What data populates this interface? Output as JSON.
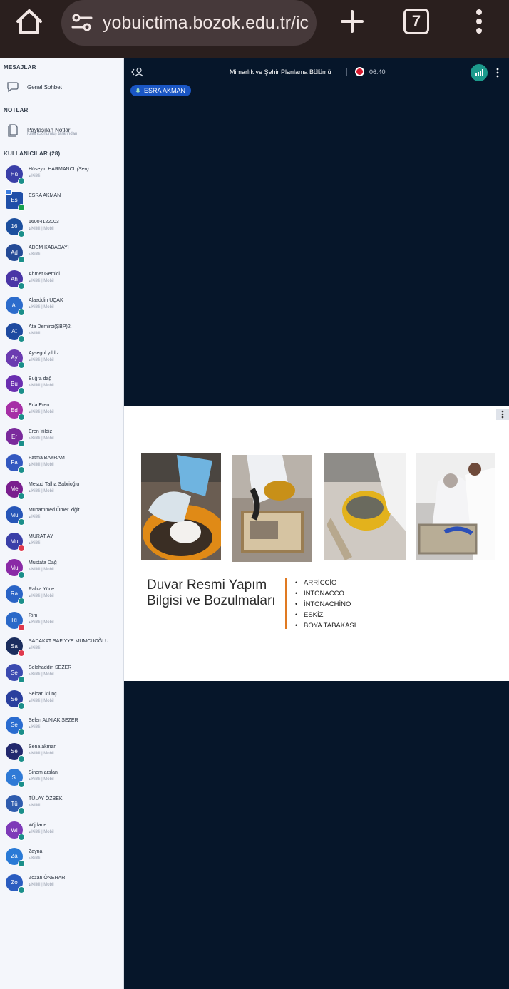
{
  "browser": {
    "url": "yobuictima.bozok.edu.tr/ic",
    "tab_count": "7"
  },
  "sidebar": {
    "messages_title": "MESAJLAR",
    "general_chat": "Genel Sohbet",
    "notes_title": "NOTLAR",
    "shared_notes": "Paylaşılan Notlar",
    "shared_notes_sub": "Kilitli (Sonumlu) tarafından",
    "users_title": "KULLANICILAR (28)"
  },
  "users": [
    {
      "initials": "Hü",
      "name": "Hüseyin HARMANCI",
      "you": "(Sen)",
      "sub": "Kilitli",
      "color": "#3a3fa8",
      "status": "normal"
    },
    {
      "initials": "Es",
      "name": "ESRA AKMAN",
      "you": "",
      "sub": "",
      "color": "#1f4fa8",
      "status": "talk",
      "presenter": true
    },
    {
      "initials": "16",
      "name": "16004122003",
      "you": "",
      "sub": "Kilitli | Mobil",
      "color": "#1c4f9e",
      "status": "normal"
    },
    {
      "initials": "Ad",
      "name": "ADEM KABADAYI",
      "you": "",
      "sub": "Kilitli",
      "color": "#244a96",
      "status": "normal"
    },
    {
      "initials": "Ah",
      "name": "Ahmet Gemici",
      "you": "",
      "sub": "Kilitli | Mobil",
      "color": "#4a35a6",
      "status": "normal"
    },
    {
      "initials": "Al",
      "name": "Alaaddin UÇAK",
      "you": "",
      "sub": "Kilitli | Mobil",
      "color": "#2c6ccc",
      "status": "normal"
    },
    {
      "initials": "At",
      "name": "Ata Demirci(ŞBP)2.",
      "you": "",
      "sub": "Kilitli",
      "color": "#1e4aa0",
      "status": "normal"
    },
    {
      "initials": "Ay",
      "name": "Aysegul yıldız",
      "you": "",
      "sub": "Kilitli | Mobil",
      "color": "#6b3bb0",
      "status": "normal"
    },
    {
      "initials": "Bu",
      "name": "Buğra dağ",
      "you": "",
      "sub": "Kilitli | Mobil",
      "color": "#6a2fb0",
      "status": "normal"
    },
    {
      "initials": "Ed",
      "name": "Eda Eren",
      "you": "",
      "sub": "Kilitli | Mobil",
      "color": "#a62fa6",
      "status": "normal"
    },
    {
      "initials": "Er",
      "name": "Eren Yildiz",
      "you": "",
      "sub": "Kilitli | Mobil",
      "color": "#7a2a9c",
      "status": "normal"
    },
    {
      "initials": "Fa",
      "name": "Fatma BAYRAM",
      "you": "",
      "sub": "Kilitli | Mobil",
      "color": "#3358c0",
      "status": "normal"
    },
    {
      "initials": "Me",
      "name": "Mesud Talha Sabrioğlu",
      "you": "",
      "sub": "Kilitli | Mobil",
      "color": "#7a1e8e",
      "status": "normal"
    },
    {
      "initials": "Mu",
      "name": "Muhammed Ömer Yiğit",
      "you": "",
      "sub": "Kilitli",
      "color": "#2756b8",
      "status": "normal"
    },
    {
      "initials": "Mu",
      "name": "MURAT AY",
      "you": "",
      "sub": "Kilitli",
      "color": "#3a3fa8",
      "status": "muted"
    },
    {
      "initials": "Mu",
      "name": "Mustafa Dağ",
      "you": "",
      "sub": "Kilitli | Mobil",
      "color": "#8a2aa6",
      "status": "normal"
    },
    {
      "initials": "Ra",
      "name": "Rabia Yüce",
      "you": "",
      "sub": "Kilitli | Mobil",
      "color": "#2a64c6",
      "status": "normal"
    },
    {
      "initials": "Ri",
      "name": "Rim",
      "you": "",
      "sub": "Kilitli | Mobil",
      "color": "#2a68c8",
      "status": "muted"
    },
    {
      "initials": "Sa",
      "name": "SADAKAT SAFİYYE MUMCUOĞLU",
      "you": "",
      "sub": "Kilitli",
      "color": "#1b2d5e",
      "status": "muted"
    },
    {
      "initials": "Se",
      "name": "Selahaddin SEZER",
      "you": "",
      "sub": "Kilitli | Mobil",
      "color": "#3b4ab0",
      "status": "normal"
    },
    {
      "initials": "Se",
      "name": "Selcan kılınç",
      "you": "",
      "sub": "Kilitli | Mobil",
      "color": "#2a3f9e",
      "status": "normal"
    },
    {
      "initials": "Se",
      "name": "Selen ALNIAK SEZER",
      "you": "",
      "sub": "Kilitli",
      "color": "#2a6cd0",
      "status": "normal"
    },
    {
      "initials": "Se",
      "name": "Sena akman",
      "you": "",
      "sub": "Kilitli | Mobil",
      "color": "#23296e",
      "status": "normal"
    },
    {
      "initials": "Si",
      "name": "Sinem arslan",
      "you": "",
      "sub": "Kilitli | Mobil",
      "color": "#2f7ad6",
      "status": "normal"
    },
    {
      "initials": "Tü",
      "name": "TÜLAY ÖZBEK",
      "you": "",
      "sub": "Kilitli",
      "color": "#2f5cae",
      "status": "normal"
    },
    {
      "initials": "Wi",
      "name": "Wijdane",
      "you": "",
      "sub": "Kilitli | Mobil",
      "color": "#7e3ab8",
      "status": "normal"
    },
    {
      "initials": "Za",
      "name": "Zayna",
      "you": "",
      "sub": "Kilitli",
      "color": "#2a7ad6",
      "status": "normal"
    },
    {
      "initials": "Zo",
      "name": "Zozan ÖNERARI",
      "you": "",
      "sub": "Kilitli | Mobil",
      "color": "#2a5cc0",
      "status": "normal"
    }
  ],
  "meeting": {
    "title": "Mimarlık ve Şehir Planlama Bölümü",
    "rec_time": "06:40",
    "speaker": "ESRA AKMAN"
  },
  "slide": {
    "title_line1": "Duvar Resmi Yapım",
    "title_line2": "Bilgisi ve Bozulmaları",
    "bullets": [
      "ARRİCCİO",
      "İNTONACCO",
      "İNTONACHİNO",
      "ESKİZ",
      "BOYA TABAKASI"
    ]
  }
}
